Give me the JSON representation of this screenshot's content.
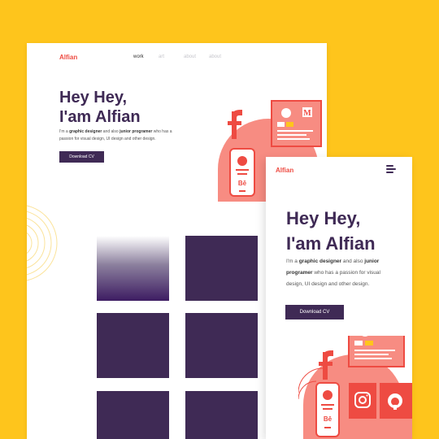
{
  "desktop": {
    "brand": "Alfian",
    "nav": [
      "work",
      "art",
      "about",
      "about"
    ],
    "hero": {
      "line1": "Hey Hey,",
      "line2": "I'am Alfian",
      "desc_pre": "I'm a ",
      "desc_role1": "graphic designer",
      "desc_mid": " and also ",
      "desc_role2": "junior programer",
      "desc_post": " who has a passion for visual design, UI design and other design."
    },
    "cta_label": "Download CV"
  },
  "mobile": {
    "brand": "Alfian",
    "hero": {
      "line1": "Hey Hey,",
      "line2": "I'am Alfian",
      "desc_pre": "I'm a ",
      "desc_role1": "graphic designer",
      "desc_mid": " and also ",
      "desc_role2": "junior programer",
      "desc_post": " who has a passion for visual design, UI design and other design."
    },
    "cta_label": "Download CV"
  },
  "illustration": {
    "medium_glyph": "M",
    "behance_glyph": "Bē",
    "facebook_glyph": "f"
  },
  "colors": {
    "background": "#FEC51C",
    "primary": "#3F2A55",
    "accent": "#EE4B42",
    "coral": "#F78C82"
  }
}
